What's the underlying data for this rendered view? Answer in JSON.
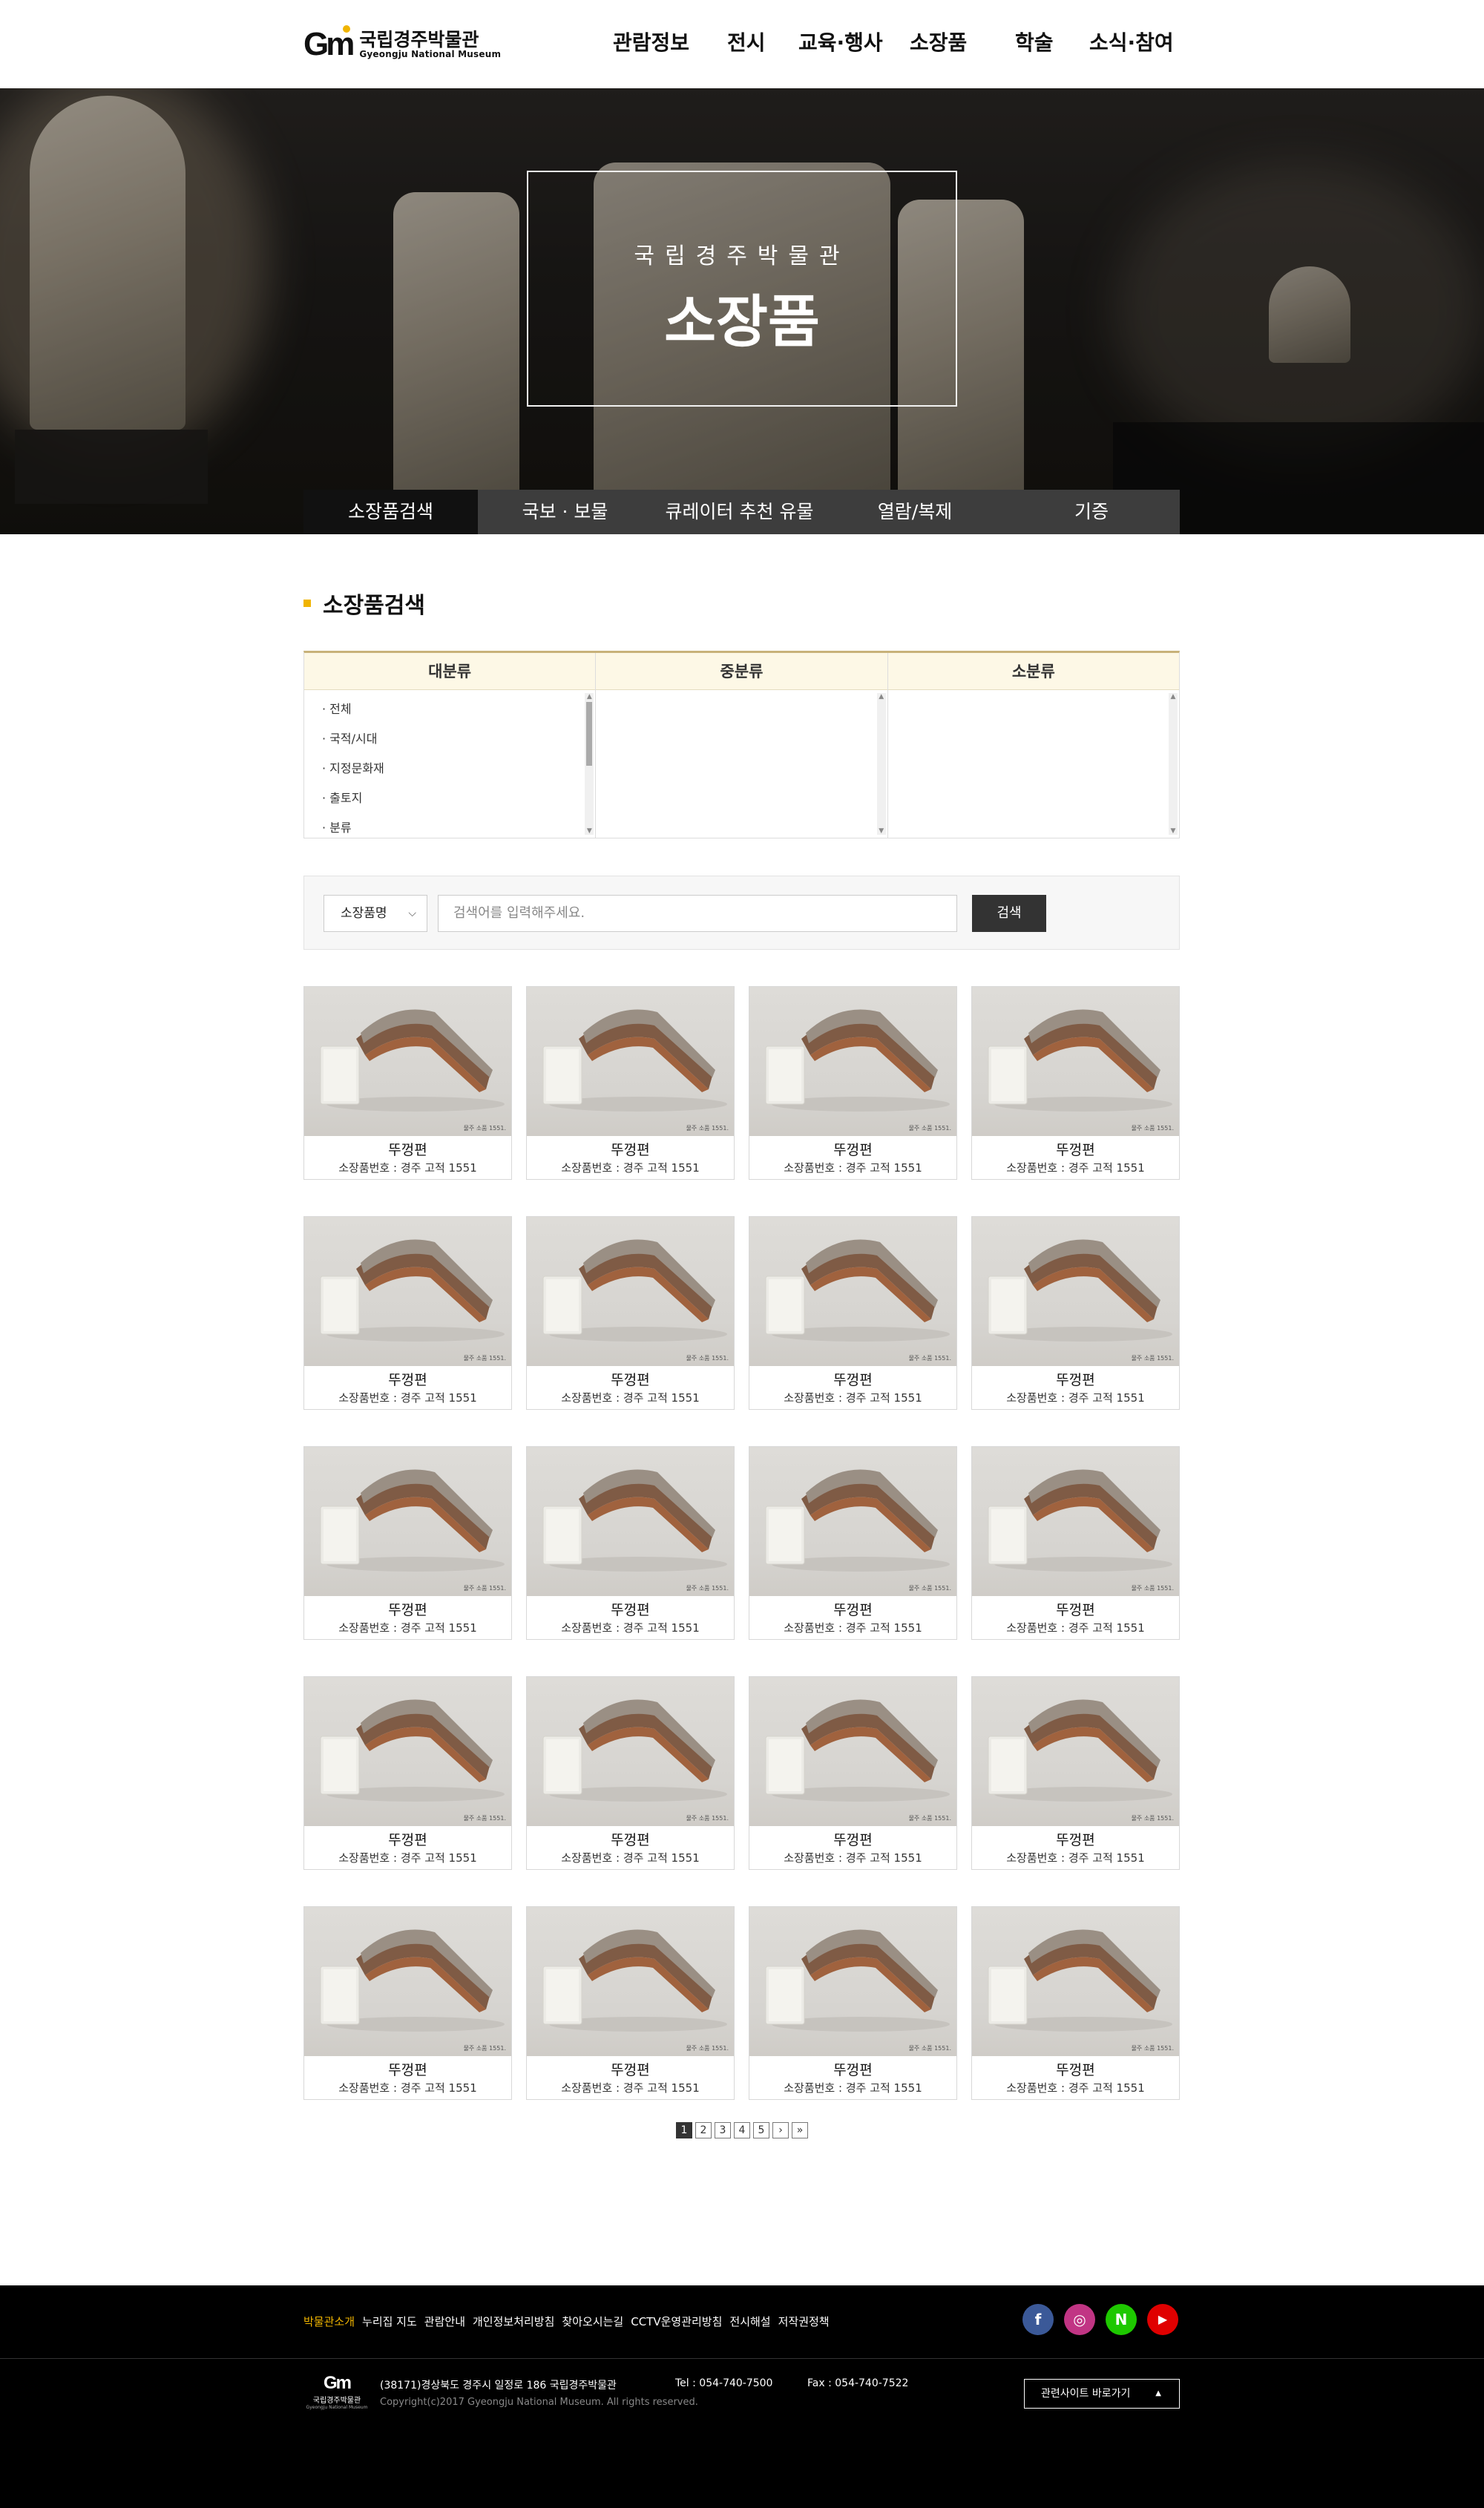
{
  "header": {
    "logo_mark": "Gm",
    "logo_ko": "국립경주박물관",
    "logo_en": "Gyeongju National Museum",
    "nav": [
      "관람정보",
      "전시",
      "교육·행사",
      "소장품",
      "학술",
      "소식·참여"
    ]
  },
  "hero": {
    "subtitle": "국립경주박물관",
    "title": "소장품"
  },
  "subnav": {
    "items": [
      "소장품검색",
      "국보 · 보물",
      "큐레이터 추천 유물",
      "열람/복제",
      "기증"
    ],
    "active_index": 0
  },
  "section": {
    "title": "소장품검색"
  },
  "category": {
    "headers": [
      "대분류",
      "중분류",
      "소분류"
    ],
    "major_items": [
      "· 전체",
      "· 국적/시대",
      "· 지정문화재",
      "· 출토지",
      "· 분류"
    ]
  },
  "search": {
    "select_value": "소장품명",
    "placeholder": "검색어를 입력해주세요.",
    "button": "검색"
  },
  "items": [
    {
      "name": "뚜껑편",
      "number": "소장품번호 : 경주 고적 1551"
    },
    {
      "name": "뚜껑편",
      "number": "소장품번호 : 경주 고적 1551"
    },
    {
      "name": "뚜껑편",
      "number": "소장품번호 : 경주 고적 1551"
    },
    {
      "name": "뚜껑편",
      "number": "소장품번호 : 경주 고적 1551"
    },
    {
      "name": "뚜껑편",
      "number": "소장품번호 : 경주 고적 1551"
    },
    {
      "name": "뚜껑편",
      "number": "소장품번호 : 경주 고적 1551"
    },
    {
      "name": "뚜껑편",
      "number": "소장품번호 : 경주 고적 1551"
    },
    {
      "name": "뚜껑편",
      "number": "소장품번호 : 경주 고적 1551"
    },
    {
      "name": "뚜껑편",
      "number": "소장품번호 : 경주 고적 1551"
    },
    {
      "name": "뚜껑편",
      "number": "소장품번호 : 경주 고적 1551"
    },
    {
      "name": "뚜껑편",
      "number": "소장품번호 : 경주 고적 1551"
    },
    {
      "name": "뚜껑편",
      "number": "소장품번호 : 경주 고적 1551"
    },
    {
      "name": "뚜껑편",
      "number": "소장품번호 : 경주 고적 1551"
    },
    {
      "name": "뚜껑편",
      "number": "소장품번호 : 경주 고적 1551"
    },
    {
      "name": "뚜껑편",
      "number": "소장품번호 : 경주 고적 1551"
    },
    {
      "name": "뚜껑편",
      "number": "소장품번호 : 경주 고적 1551"
    },
    {
      "name": "뚜껑편",
      "number": "소장품번호 : 경주 고적 1551"
    },
    {
      "name": "뚜껑편",
      "number": "소장품번호 : 경주 고적 1551"
    },
    {
      "name": "뚜껑편",
      "number": "소장품번호 : 경주 고적 1551"
    },
    {
      "name": "뚜껑편",
      "number": "소장품번호 : 경주 고적 1551"
    }
  ],
  "item_photo_label": "물주 소품 1551.",
  "pagination": {
    "pages": [
      "1",
      "2",
      "3",
      "4",
      "5"
    ],
    "current": "1",
    "next": "›",
    "last": "»"
  },
  "footer": {
    "links": [
      "박물관소개",
      "누리집 지도",
      "관람안내",
      "개인정보처리방침",
      "찾아오시는길",
      "CCTV운영관리방침",
      "전시해설",
      "저작권정책"
    ],
    "sns": [
      {
        "icon": "facebook-icon",
        "glyph": "f",
        "color": "#3b5998"
      },
      {
        "icon": "instagram-icon",
        "glyph": "◎",
        "color": "#c13584"
      },
      {
        "icon": "naver-icon",
        "glyph": "N",
        "color": "#1ec800"
      },
      {
        "icon": "youtube-icon",
        "glyph": "▶",
        "color": "#e00000"
      }
    ],
    "logo_mark": "Gm",
    "logo_ko": "국립경주박물관",
    "logo_en": "Gyeongju National Museum",
    "address": "(38171)경상북도 경주시 일정로 186 국립경주박물관",
    "tel": "Tel : 054-740-7500",
    "fax": "Fax : 054-740-7522",
    "copyright": "Copyright(c)2017 Gyeongju National Museum. All rights reserved.",
    "related_sites": "관련사이트 바로가기"
  },
  "colors": {
    "accent": "#f0b400",
    "subnav_bg": "#3d3d3d",
    "subnav_active": "#111111",
    "category_border": "#c8b27a",
    "category_head_bg": "#fdf8e6"
  }
}
